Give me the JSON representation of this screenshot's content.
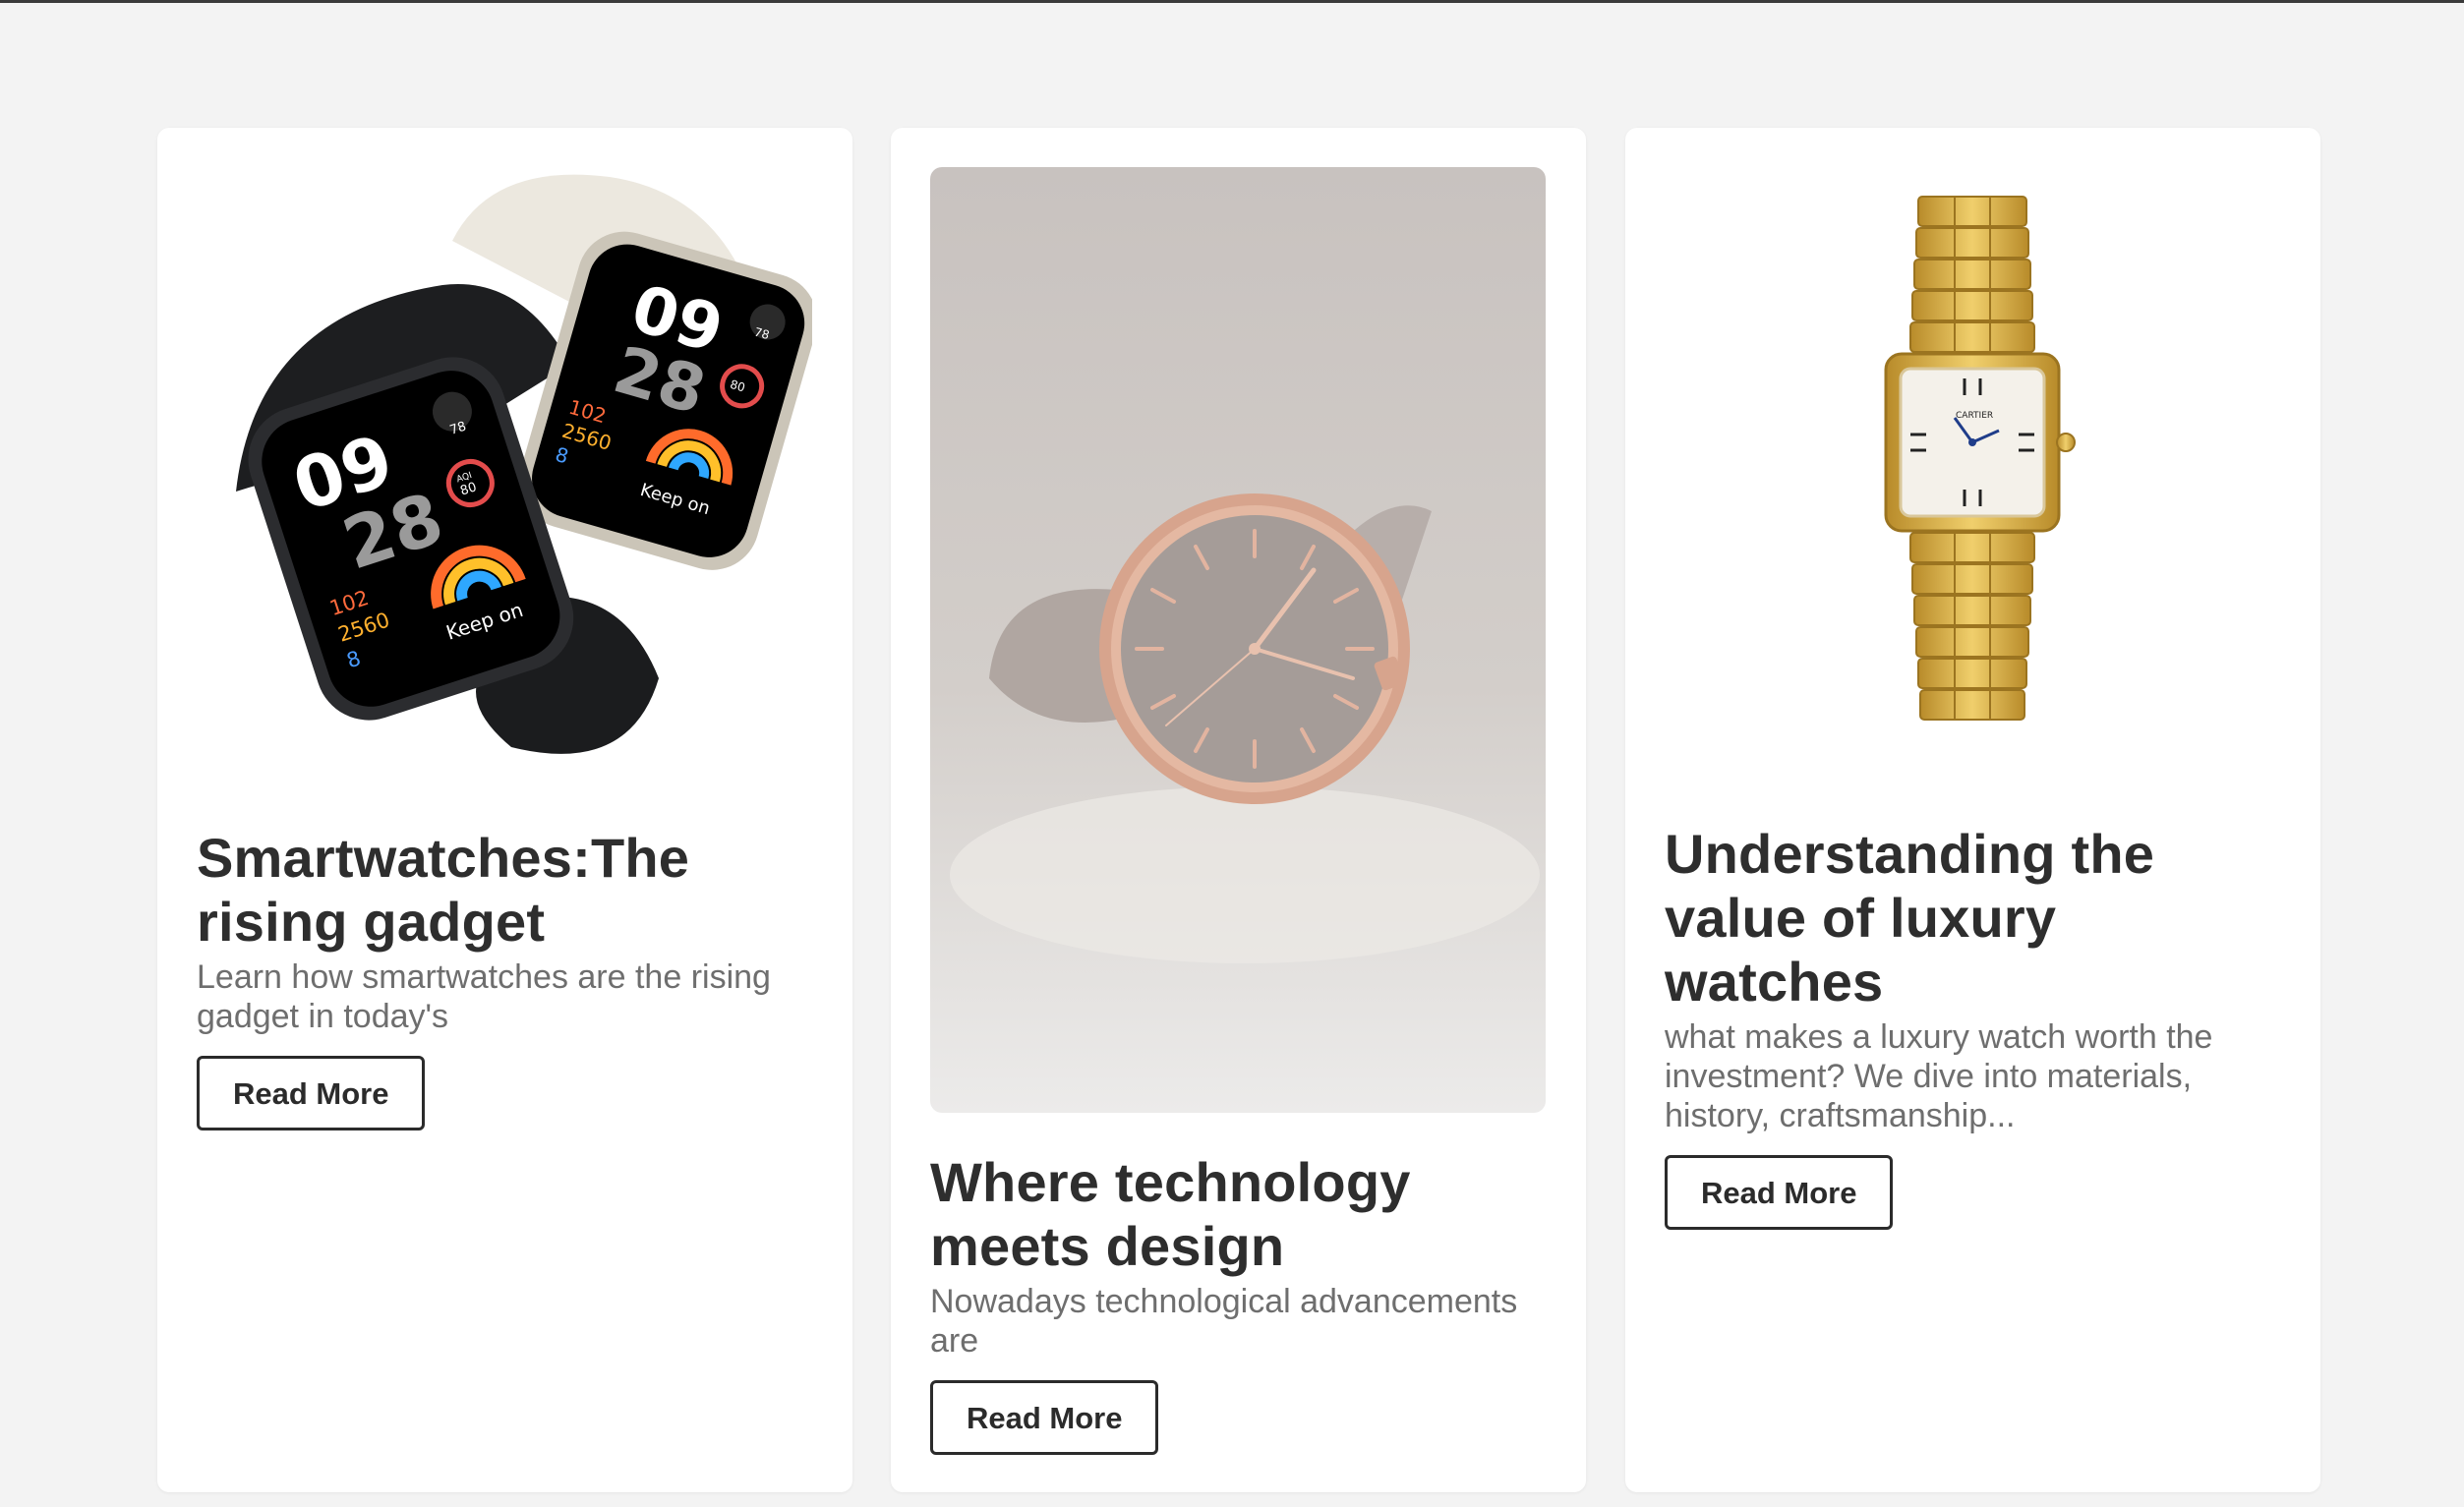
{
  "colors": {
    "page_background": "#f3f3f3",
    "card_background": "#ffffff",
    "title": "#2e2e2e",
    "excerpt": "#6e6e6e",
    "button_border": "#2b2b2b"
  },
  "cards": [
    {
      "image": "smartwatches-image",
      "watch_face": {
        "hour": "09",
        "minute": "28",
        "heart": "78",
        "aqi_label": "AQI",
        "aqi": "80",
        "stat1": "102",
        "stat2": "2560",
        "stat3": "8",
        "keep_on": "Keep on"
      },
      "title": "Smartwatches:The rising gadget",
      "excerpt": "Learn how smartwatches are the rising gadget in today's",
      "button": "Read More"
    },
    {
      "image": "rose-gold-watch-image",
      "title": "Where technology meets design",
      "excerpt": "Nowadays technological advancements are",
      "button": "Read More"
    },
    {
      "image": "luxury-gold-watch-image",
      "watch_brand": "CARTIER",
      "title": "Understanding the value of luxury watches",
      "excerpt": "what makes a luxury watch worth the investment? We dive into materials, history, craftsmanship...",
      "button": "Read More"
    }
  ]
}
